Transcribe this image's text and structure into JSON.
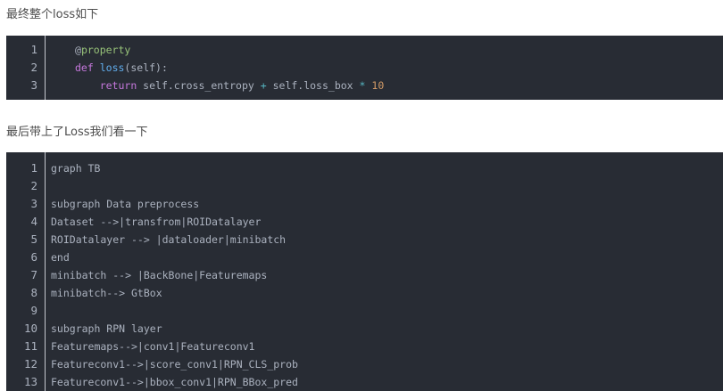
{
  "paragraph1": "最终整个loss如下",
  "paragraph2": "最后带上了Loss我们看一下",
  "code_block_1": {
    "lines": [
      {
        "n": "1",
        "indent": "",
        "tokens": [
          {
            "t": "@",
            "c": "tok-plain"
          },
          {
            "t": "property",
            "c": "tok-deco"
          }
        ]
      },
      {
        "n": "2",
        "indent": "",
        "tokens": [
          {
            "t": "def",
            "c": "tok-kw"
          },
          {
            "t": " ",
            "c": "tok-plain"
          },
          {
            "t": "loss",
            "c": "tok-fn"
          },
          {
            "t": "(self):",
            "c": "tok-plain"
          }
        ]
      },
      {
        "n": "3",
        "indent": "    ",
        "tokens": [
          {
            "t": "return",
            "c": "tok-kw"
          },
          {
            "t": " self.cross_entropy ",
            "c": "tok-plain"
          },
          {
            "t": "+",
            "c": "tok-op"
          },
          {
            "t": " self.loss_box ",
            "c": "tok-plain"
          },
          {
            "t": "*",
            "c": "tok-op"
          },
          {
            "t": " ",
            "c": "tok-plain"
          },
          {
            "t": "10",
            "c": "tok-num"
          }
        ]
      }
    ]
  },
  "code_block_2": {
    "lines": [
      {
        "n": "1",
        "text": "graph TB"
      },
      {
        "n": "2",
        "text": ""
      },
      {
        "n": "3",
        "text": "subgraph Data preprocess"
      },
      {
        "n": "4",
        "text": "Dataset -->|transfrom|ROIDatalayer"
      },
      {
        "n": "5",
        "text": "ROIDatalayer --> |dataloader|minibatch"
      },
      {
        "n": "6",
        "text": "end"
      },
      {
        "n": "7",
        "text": "minibatch --> |BackBone|Featuremaps"
      },
      {
        "n": "8",
        "text": "minibatch--> GtBox"
      },
      {
        "n": "9",
        "text": ""
      },
      {
        "n": "10",
        "text": "subgraph RPN layer"
      },
      {
        "n": "11",
        "text": "Featuremaps-->|conv1|Featureconv1"
      },
      {
        "n": "12",
        "text": "Featureconv1-->|score_conv1|RPN_CLS_prob"
      },
      {
        "n": "13",
        "text": "Featureconv1-->|bbox_conv1|RPN_BBox_pred"
      }
    ]
  },
  "colors": {
    "code_bg": "#282c34",
    "code_text": "#abb2bf",
    "keyword": "#c678dd",
    "function": "#61aeee",
    "decorator": "#98c379",
    "operator": "#56b6c2",
    "number": "#d19a66",
    "paragraph_text": "#4d4d4d"
  }
}
